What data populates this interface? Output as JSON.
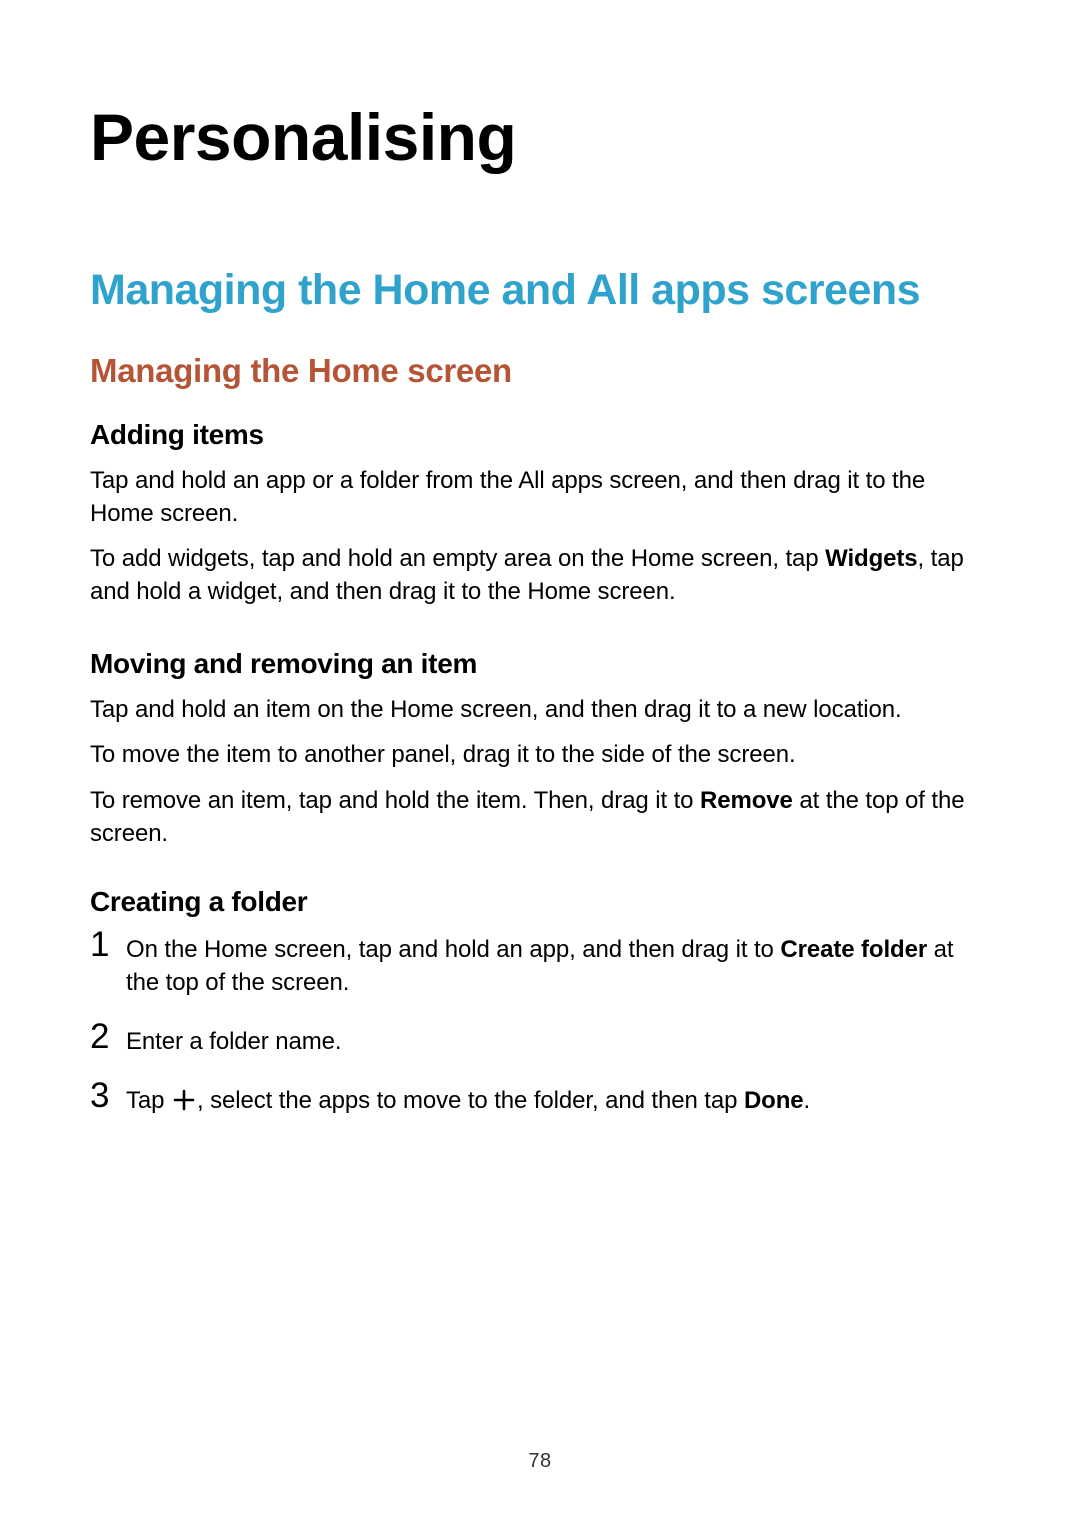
{
  "page_number": "78",
  "chapter_title": "Personalising",
  "section_title": "Managing the Home and All apps screens",
  "subsection_title": "Managing the Home screen",
  "adding_items": {
    "heading": "Adding items",
    "p1": "Tap and hold an app or a folder from the All apps screen, and then drag it to the Home screen.",
    "p2_pre": "To add widgets, tap and hold an empty area on the Home screen, tap ",
    "p2_bold": "Widgets",
    "p2_post": ", tap and hold a widget, and then drag it to the Home screen."
  },
  "moving_removing": {
    "heading": "Moving and removing an item",
    "p1": "Tap and hold an item on the Home screen, and then drag it to a new location.",
    "p2": "To move the item to another panel, drag it to the side of the screen.",
    "p3_pre": "To remove an item, tap and hold the item. Then, drag it to ",
    "p3_bold": "Remove",
    "p3_post": " at the top of the screen."
  },
  "creating_folder": {
    "heading": "Creating a folder",
    "steps": {
      "num1": "1",
      "s1_pre": "On the Home screen, tap and hold an app, and then drag it to ",
      "s1_bold": "Create folder",
      "s1_post": " at the top of the screen.",
      "num2": "2",
      "s2": "Enter a folder name.",
      "num3": "3",
      "s3_pre": "Tap ",
      "s3_mid": ", select the apps to move to the folder, and then tap ",
      "s3_bold": "Done",
      "s3_post": "."
    }
  }
}
